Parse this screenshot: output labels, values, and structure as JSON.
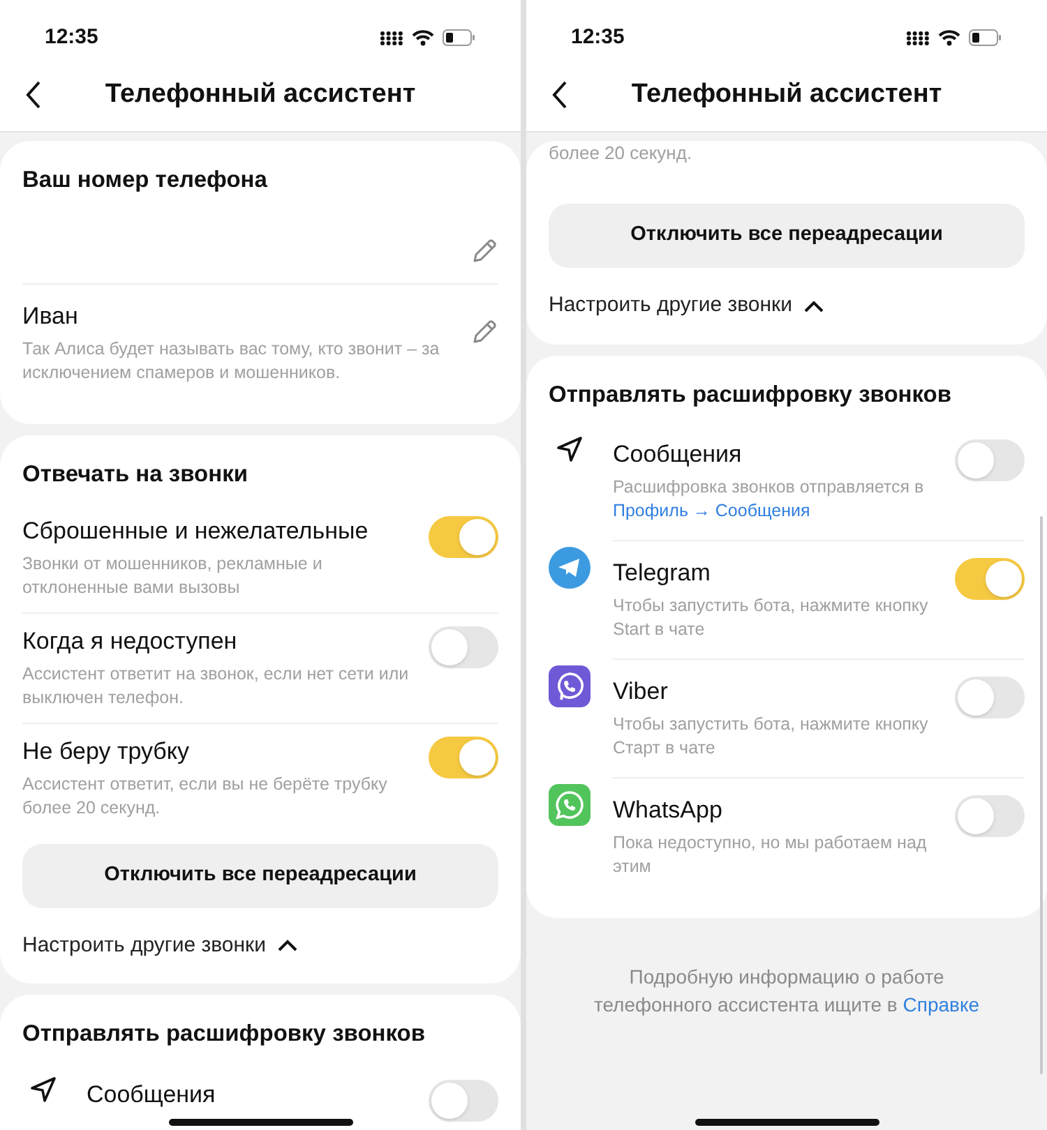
{
  "screens": [
    {
      "time": "12:35",
      "title": "Телефонный ассистент",
      "cards": [
        {
          "title": "Ваш номер телефона",
          "items": [
            {
              "kind": "editable"
            },
            {
              "kind": "editable",
              "title": "Иван",
              "subtitle": "Так Алиса будет называть вас тому, кто звонит – за исключением спамеров и мошенников."
            }
          ]
        },
        {
          "title": "Отвечать на звонки",
          "items": [
            {
              "kind": "toggle",
              "title": "Сброшенные и нежелательные",
              "subtitle": "Звонки от мошенников, рекламные и отклоненные вами вызовы",
              "on": true
            },
            {
              "kind": "toggle",
              "title": "Когда я недоступен",
              "subtitle": "Ассистент ответит на звонок, если нет сети или выключен телефон.",
              "on": false
            },
            {
              "kind": "toggle",
              "title": "Не беру трубку",
              "subtitle": "Ассистент ответит, если вы не берёте трубку более 20 секунд.",
              "on": true
            }
          ],
          "button": "Отключить все переадресации",
          "expander": {
            "label": "Настроить другие звонки",
            "expanded": true
          }
        },
        {
          "title": "Отправлять расшифровку звонков",
          "items": [
            {
              "kind": "messages",
              "title": "Сообщения",
              "on": false
            }
          ]
        }
      ]
    },
    {
      "time": "12:35",
      "title": "Телефонный ассистент",
      "cards": [
        {
          "items": [
            {
              "kind": "note",
              "text": "более 20 секунд."
            }
          ],
          "button": "Отключить все переадресации",
          "expander": {
            "label": "Настроить другие звонки",
            "expanded": true
          }
        },
        {
          "title": "Отправлять расшифровку звонков",
          "items": [
            {
              "kind": "messages",
              "title": "Сообщения",
              "subtitle": "Расшифровка звонков отправляется в",
              "link": "Профиль → Сообщения",
              "on": false
            },
            {
              "kind": "telegram",
              "title": "Telegram",
              "subtitle": "Чтобы запустить бота, нажмите кнопку Start в чате",
              "on": true
            },
            {
              "kind": "viber",
              "title": "Viber",
              "subtitle": "Чтобы запустить бота, нажмите кнопку Старт в чате",
              "on": false
            },
            {
              "kind": "whatsapp",
              "title": "WhatsApp",
              "subtitle": "Пока недоступно, но мы работаем над этим",
              "on": false
            }
          ]
        }
      ],
      "footer": {
        "text": "Подробную информацию о работе телефонного ассистента ищите в",
        "link": "Справке"
      }
    }
  ]
}
